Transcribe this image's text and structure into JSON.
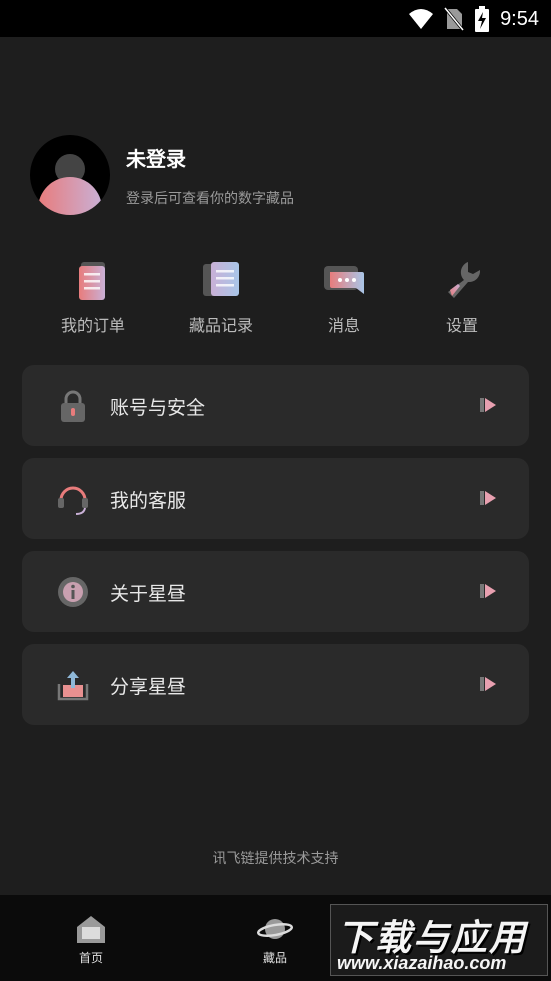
{
  "status_bar": {
    "time": "9:54",
    "icons": [
      "wifi-icon",
      "no-sim-icon",
      "battery-charging-icon"
    ]
  },
  "profile": {
    "name": "未登录",
    "subtitle": "登录后可查看你的数字藏品"
  },
  "quick_actions": [
    {
      "label": "我的订单",
      "icon": "orders-icon"
    },
    {
      "label": "藏品记录",
      "icon": "collection-record-icon"
    },
    {
      "label": "消息",
      "icon": "message-icon"
    },
    {
      "label": "设置",
      "icon": "wrench-icon"
    }
  ],
  "menu": [
    {
      "label": "账号与安全",
      "icon": "lock-icon"
    },
    {
      "label": "我的客服",
      "icon": "headset-icon"
    },
    {
      "label": "关于星昼",
      "icon": "info-icon"
    },
    {
      "label": "分享星昼",
      "icon": "share-icon"
    }
  ],
  "footer": {
    "text": "讯飞链提供技术支持"
  },
  "tabbar": [
    {
      "label": "首页",
      "icon": "home-icon"
    },
    {
      "label": "藏品",
      "icon": "planet-icon"
    }
  ],
  "watermark": {
    "line1": "下载与应用",
    "line2": "www.xiazaihao.com"
  },
  "colors": {
    "background": "#1e1e1e",
    "card": "#2a2a2a",
    "accent_pink": "#e87c7c",
    "accent_lavender": "#c9b0d6"
  }
}
